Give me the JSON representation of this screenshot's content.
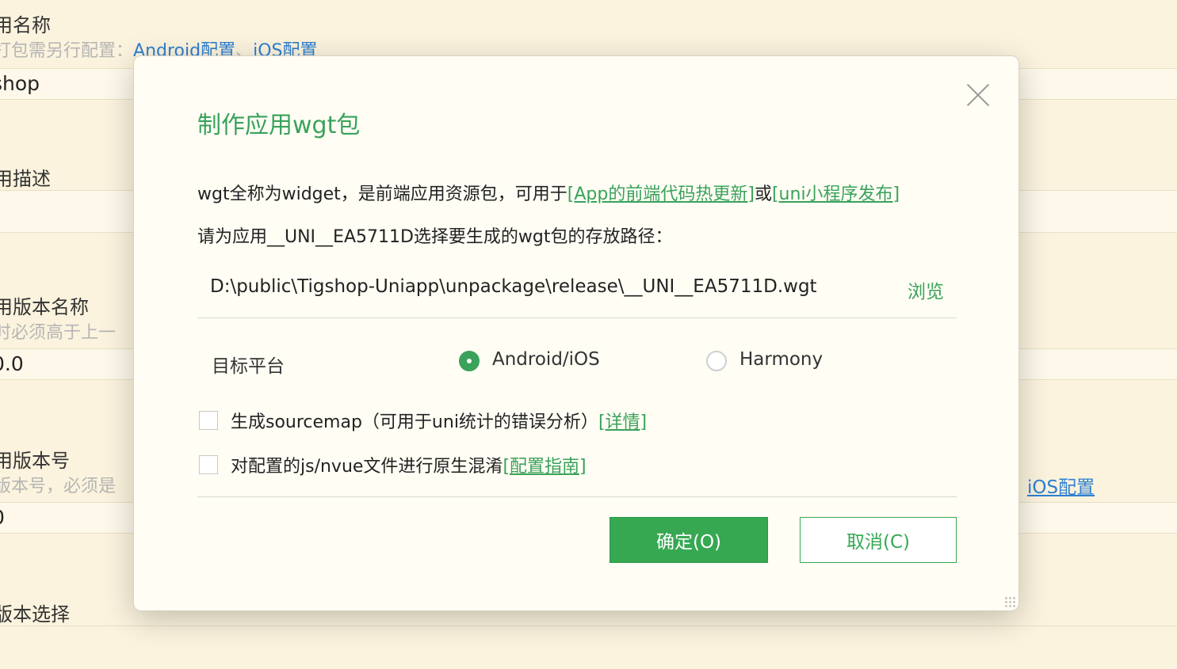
{
  "background": {
    "app_name_label": "用名称",
    "app_name_hint_prefix": "打包需另行配置：",
    "app_name_hint_android": "Android配置",
    "app_name_hint_sep": "、",
    "app_name_hint_ios": "iOS配置",
    "app_name_value": "shop",
    "app_desc_label": "用描述",
    "version_name_label": "用版本名称",
    "version_name_hint": "时必须高于上一",
    "version_name_value": "0.0",
    "version_code_label": "用版本号",
    "version_code_hint": "版本号，必须是",
    "version_code_value": "0",
    "version_code_ios_link": "iOS配置",
    "version_select_label": "版本选择"
  },
  "dialog": {
    "title": "制作应用wgt包",
    "intro_text": "wgt全称为widget，是前端应用资源包，可用于",
    "intro_link1": "[App的前端代码热更新]",
    "intro_or": "或",
    "intro_link2": "[uni小程序发布]",
    "prompt": "请为应用__UNI__EA5711D选择要生成的wgt包的存放路径：",
    "path_value": "D:\\public\\Tigshop-Uniapp\\unpackage\\release\\__UNI__EA5711D.wgt",
    "browse_label": "浏览",
    "platform_label": "目标平台",
    "platform_option_android": "Android/iOS",
    "platform_option_harmony": "Harmony",
    "platform_selected": "Android/iOS",
    "sourcemap_label": "生成sourcemap（可用于uni统计的错误分析）",
    "sourcemap_link": "[详情]",
    "sourcemap_checked": false,
    "obfuscate_label": "对配置的js/nvue文件进行原生混淆",
    "obfuscate_link": "[配置指南]",
    "obfuscate_checked": false,
    "ok_label": "确定(O)",
    "cancel_label": "取消(C)"
  },
  "colors": {
    "accent_green": "#36a852",
    "link_blue": "#2f7fd1",
    "page_background": "#fbf3dd",
    "dialog_background": "#fffdf4"
  }
}
